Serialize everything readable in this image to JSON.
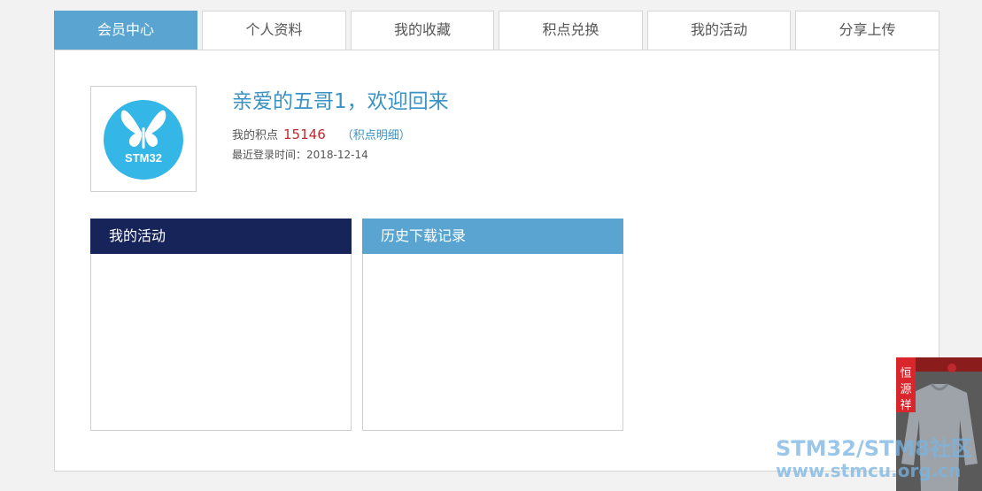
{
  "tabs": [
    {
      "label": "会员中心",
      "active": true
    },
    {
      "label": "个人资料",
      "active": false
    },
    {
      "label": "我的收藏",
      "active": false
    },
    {
      "label": "积点兑换",
      "active": false
    },
    {
      "label": "我的活动",
      "active": false
    },
    {
      "label": "分享上传",
      "active": false
    }
  ],
  "profile": {
    "avatar_text": "STM32",
    "welcome": "亲爱的五哥1，欢迎回来",
    "points_label": "我的积点",
    "points_value": "15146",
    "points_link": "（积点明细）",
    "login_label": "最近登录时间：",
    "login_date": "2018-12-14"
  },
  "boxes": [
    {
      "title": "我的活动",
      "color": "#17245a"
    },
    {
      "title": "历史下载记录",
      "color": "#5aa4d1"
    }
  ],
  "ad": {
    "brand": "恒源祥"
  },
  "watermark": {
    "line1": "STM32/STM8社区",
    "line2": "www.stmcu.org.cn"
  },
  "colors": {
    "accent": "#5aa4d1",
    "title_blue": "#3a93c4",
    "points_red": "#c0282f",
    "navy": "#17245a"
  }
}
